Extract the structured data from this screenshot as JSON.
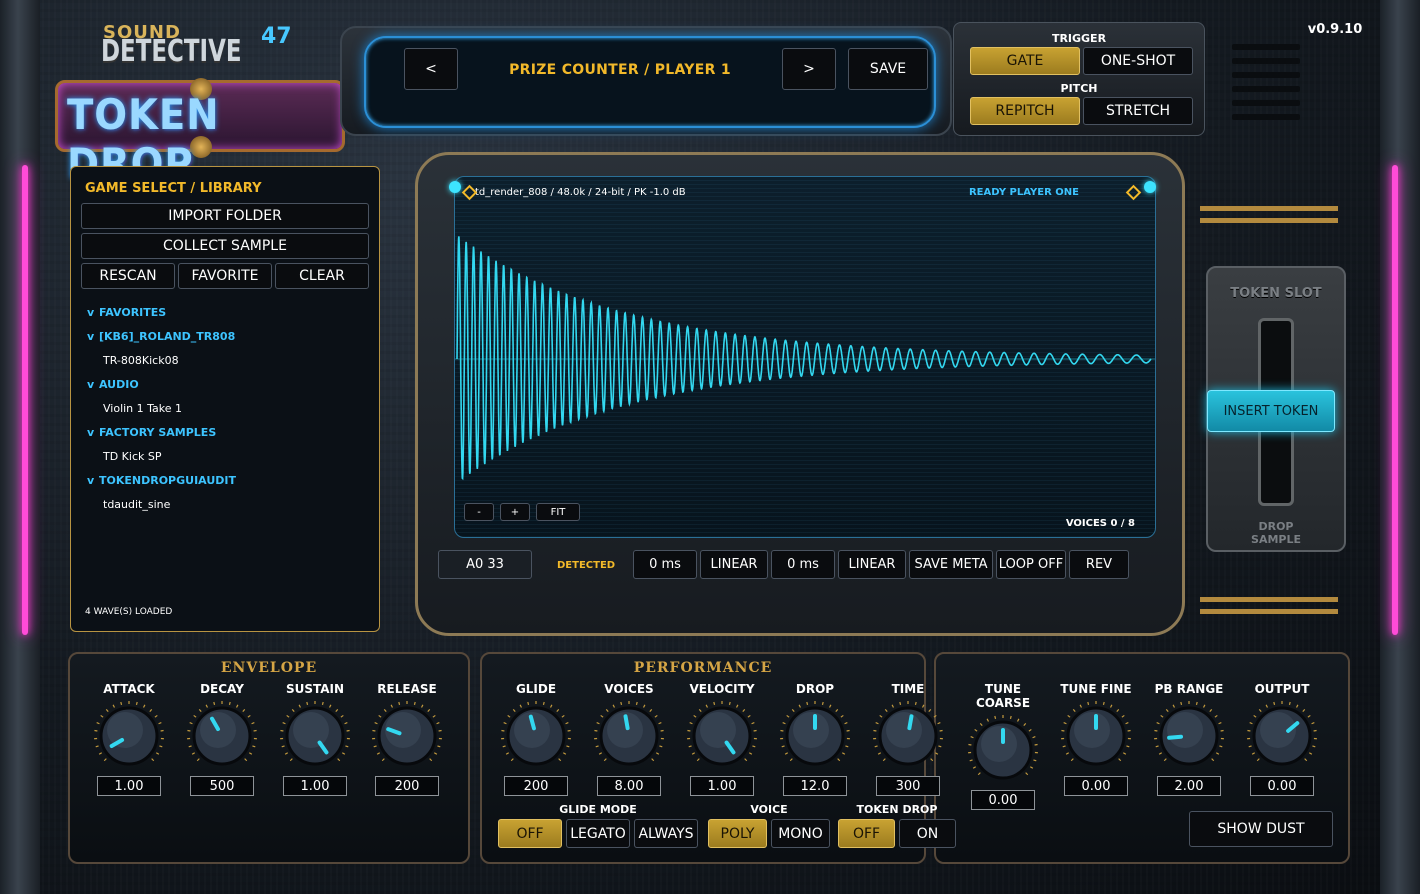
{
  "app": {
    "logo_sound": "SOUND",
    "logo_detective": "DETECTIVE",
    "logo_number": "47",
    "logo_product": "TOKEN DROP",
    "version": "v0.9.10"
  },
  "preset": {
    "prev_label": "<",
    "next_label": ">",
    "name": "PRIZE COUNTER  /  PLAYER 1",
    "save_label": "SAVE"
  },
  "trigger": {
    "label": "TRIGGER",
    "options": [
      "GATE",
      "ONE-SHOT"
    ],
    "selected": "GATE"
  },
  "pitch": {
    "label": "PITCH",
    "options": [
      "REPITCH",
      "STRETCH"
    ],
    "selected": "REPITCH"
  },
  "library": {
    "title": "GAME SELECT / LIBRARY",
    "import_label": "IMPORT FOLDER",
    "collect_label": "COLLECT SAMPLE",
    "rescan_label": "RESCAN",
    "favorite_label": "FAVORITE",
    "clear_label": "CLEAR",
    "tree": [
      {
        "type": "group",
        "caret": "v",
        "label": "FAVORITES"
      },
      {
        "type": "group",
        "caret": "v",
        "label": "[KB6]_ROLAND_TR808"
      },
      {
        "type": "item",
        "label": "TR-808Kick08"
      },
      {
        "type": "group",
        "caret": "v",
        "label": "AUDIO"
      },
      {
        "type": "item",
        "label": "Violin 1 Take 1"
      },
      {
        "type": "group",
        "caret": "v",
        "label": "FACTORY SAMPLES"
      },
      {
        "type": "item",
        "label": "TD Kick SP"
      },
      {
        "type": "group",
        "caret": "v",
        "label": "TOKENDROPGUIAUDIT"
      },
      {
        "type": "item",
        "label": "tdaudit_sine"
      }
    ],
    "status": "4 WAVE(S) LOADED"
  },
  "waveform": {
    "info": "td_render_808  /  48.0k  /  24-bit  /  PK -1.0 dB",
    "status": "READY PLAYER ONE",
    "zoom_out": "-",
    "zoom_in": "+",
    "fit": "FIT",
    "voices": "VOICES 0 / 8",
    "color": "#33d8f0"
  },
  "sample": {
    "root_note": "A0 33",
    "detected": "DETECTED",
    "fade_in": "0 ms",
    "fade_in_curve": "LINEAR",
    "fade_out": "0 ms",
    "fade_out_curve": "LINEAR",
    "save_meta": "SAVE META",
    "loop": "LOOP OFF",
    "reverse": "REV"
  },
  "token_slot": {
    "title": "TOKEN SLOT",
    "insert_label": "INSERT TOKEN",
    "drop_label_1": "DROP",
    "drop_label_2": "SAMPLE"
  },
  "envelope": {
    "title": "ENVELOPE",
    "knobs": [
      {
        "label": "ATTACK",
        "value": "1.00",
        "angle": -120
      },
      {
        "label": "DECAY",
        "value": "500",
        "angle": -30
      },
      {
        "label": "SUSTAIN",
        "value": "1.00",
        "angle": 145
      },
      {
        "label": "RELEASE",
        "value": "200",
        "angle": -70
      }
    ]
  },
  "performance": {
    "title": "PERFORMANCE",
    "knobs": [
      {
        "label": "GLIDE",
        "value": "200",
        "angle": -15
      },
      {
        "label": "VOICES",
        "value": "8.00",
        "angle": -10
      },
      {
        "label": "VELOCITY",
        "value": "1.00",
        "angle": 145
      },
      {
        "label": "DROP",
        "value": "12.0",
        "angle": 0
      },
      {
        "label": "TIME",
        "value": "300",
        "angle": 10
      }
    ],
    "glide_mode_label": "GLIDE MODE",
    "glide_modes": [
      "OFF",
      "LEGATO",
      "ALWAYS"
    ],
    "voice_label": "VOICE",
    "voice_modes": [
      "POLY",
      "MONO"
    ],
    "token_drop_label": "TOKEN DROP",
    "token_drop_modes": [
      "OFF",
      "ON"
    ]
  },
  "tune": {
    "knobs": [
      {
        "label": "TUNE COARSE",
        "value": "0.00",
        "angle": 0
      },
      {
        "label": "TUNE FINE",
        "value": "0.00",
        "angle": 0
      },
      {
        "label": "PB RANGE",
        "value": "2.00",
        "angle": -95
      },
      {
        "label": "OUTPUT",
        "value": "0.00",
        "angle": 50
      }
    ],
    "show_dust_label": "SHOW DUST"
  },
  "colors": {
    "accent_gold": "#c8a232",
    "accent_cyan": "#33d8f0",
    "neon_pink": "#ff4bd8"
  }
}
